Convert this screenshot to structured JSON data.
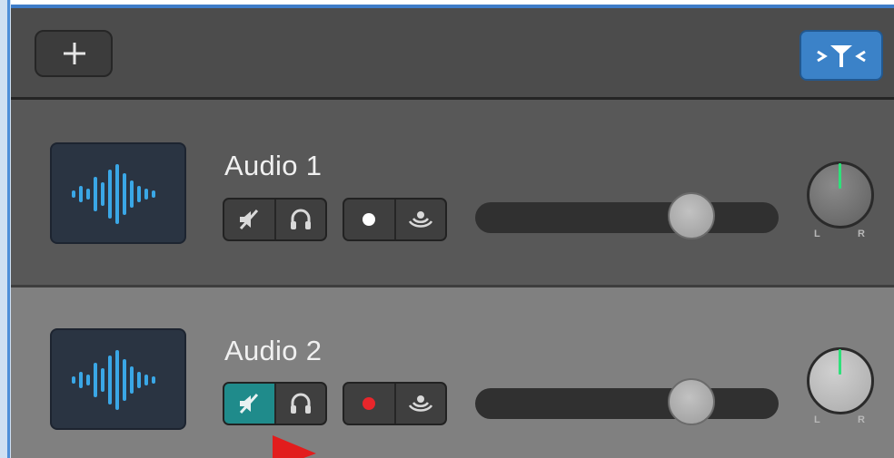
{
  "toolbar": {
    "add_icon": "plus-icon",
    "filter_icon": "track-filter-icon",
    "accent_color": "#3b82c8"
  },
  "tracks": [
    {
      "name": "Audio 1",
      "icon": "waveform-icon",
      "mute_active": false,
      "record_color": "#ffffff",
      "volume_fraction": 0.75,
      "pan_label_left": "L",
      "pan_label_right": "R"
    },
    {
      "name": "Audio 2",
      "icon": "waveform-icon",
      "mute_active": true,
      "record_color": "#e8262b",
      "volume_fraction": 0.75,
      "pan_label_left": "L",
      "pan_label_right": "R"
    }
  ],
  "colors": {
    "mute_active": "#1f8b8b",
    "pan_indicator": "#2ee07a",
    "waveform": "#3aa7e6",
    "annotation_arrow": "#e21d1d"
  }
}
